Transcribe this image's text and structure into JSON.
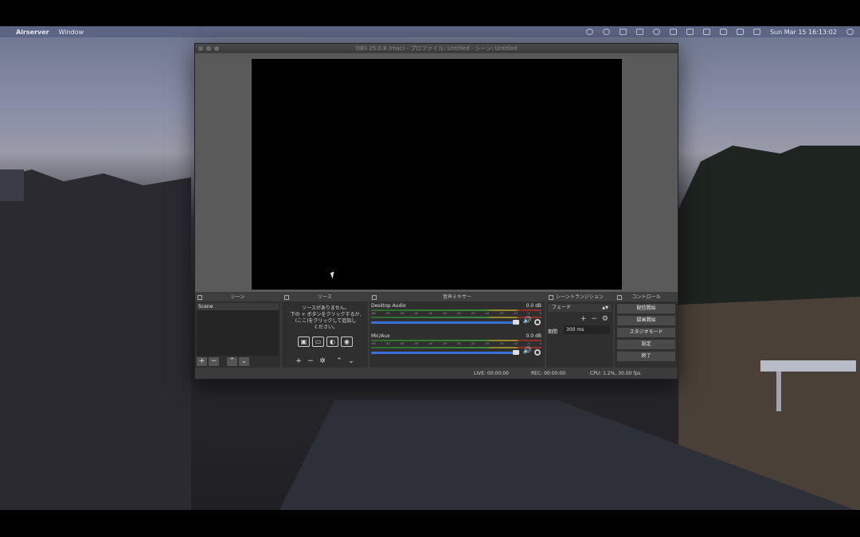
{
  "menubar": {
    "apple": "",
    "app_name": "Airserver",
    "menu_window": "Window",
    "clock": "Sun Mar 15  16:13:02"
  },
  "obs": {
    "title": "OBS 25.0.8 (mac) - プロファイル: Untitled - シーン: Untitled",
    "docks": {
      "scenes": {
        "title": "シーン",
        "items": [
          "Scene"
        ]
      },
      "sources": {
        "title": "ソース",
        "empty_msg_1": "ソースがありません。",
        "empty_msg_2": "下の + ボタンをクリックするか,",
        "empty_msg_3": "(ここ)をクリックして追加し",
        "empty_msg_4": "ください。"
      },
      "mixer": {
        "title": "音声ミキサー",
        "channels": [
          {
            "name": "Desktop Audio",
            "db": "0.0 dB"
          },
          {
            "name": "Mic/Aux",
            "db": "0.0 dB"
          }
        ],
        "ticks": [
          "-60",
          "-55",
          "-50",
          "-45",
          "-40",
          "-35",
          "-30",
          "-25",
          "-20",
          "-15",
          "-10",
          "-5",
          "0"
        ]
      },
      "transitions": {
        "title": "シーントランジション",
        "selected": "フェード",
        "duration_label": "期間",
        "duration_value": "300 ms"
      },
      "controls": {
        "title": "コントロール",
        "start_streaming": "配信開始",
        "start_recording": "録画開始",
        "studio_mode": "スタジオモード",
        "settings": "設定",
        "exit": "終了"
      }
    },
    "status": {
      "live": "LIVE: 00:00:00",
      "rec": "REC: 00:00:00",
      "cpu": "CPU: 1.2%, 30.00 fps"
    }
  },
  "colors": {
    "window_bg": "#3b3b3b",
    "dock_bg": "#2f2f2f",
    "volume_blue": "#3b6fd8"
  }
}
